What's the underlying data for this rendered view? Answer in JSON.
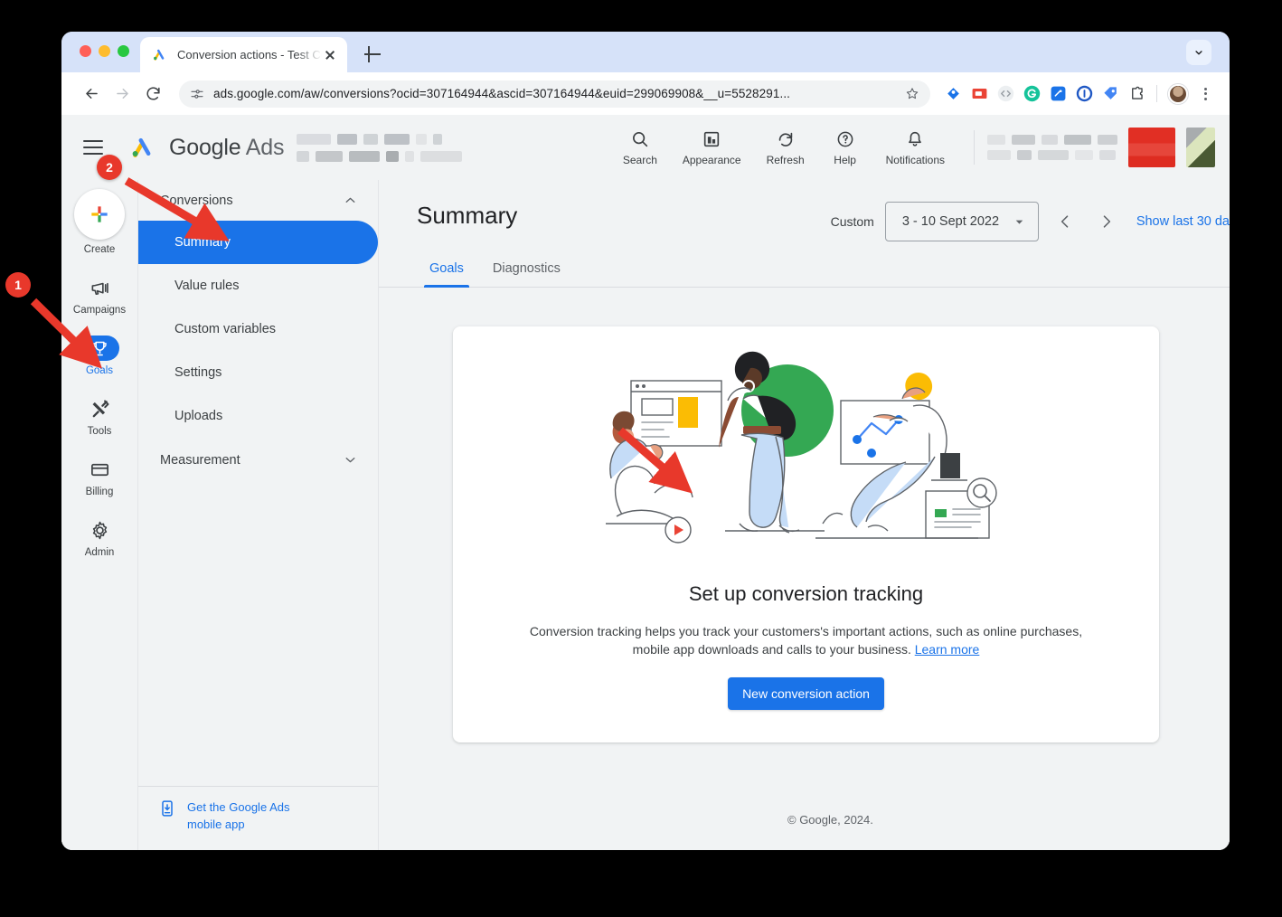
{
  "browser": {
    "tab": {
      "title": "Conversion actions - Test Cor",
      "favicon": "google-ads-favicon"
    },
    "new_tab_label": "+",
    "url": "ads.google.com/aw/conversions?ocid=307164944&ascid=307164944&euid=299069908&__u=5528291...",
    "extensions": [
      "tag-assistant-icon",
      "coupon-icon",
      "code-inspector-icon",
      "grammarly-icon",
      "tag-manager-icon",
      "1password-icon",
      "tag-blue-icon",
      "extensions-puzzle-icon"
    ],
    "profile": "profile-avatar",
    "menu": "chrome-menu-icon"
  },
  "appbar": {
    "menu_label": "hamburger-menu",
    "brand_google": "Google",
    "brand_ads": "Ads",
    "account_redacted": "[redacted account name]",
    "actions": [
      {
        "label": "Search",
        "icon": "search-icon"
      },
      {
        "label": "Appearance",
        "icon": "appearance-icon"
      },
      {
        "label": "Refresh",
        "icon": "refresh-icon"
      },
      {
        "label": "Help",
        "icon": "help-icon"
      },
      {
        "label": "Notifications",
        "icon": "bell-icon"
      }
    ]
  },
  "rail": {
    "items": [
      {
        "label": "Create",
        "icon": "plus-icon",
        "active": false
      },
      {
        "label": "Campaigns",
        "icon": "megaphone-icon",
        "active": false
      },
      {
        "label": "Goals",
        "icon": "trophy-icon",
        "active": true
      },
      {
        "label": "Tools",
        "icon": "tools-icon",
        "active": false
      },
      {
        "label": "Billing",
        "icon": "billing-card-icon",
        "active": false
      },
      {
        "label": "Admin",
        "icon": "gear-icon",
        "active": false
      }
    ]
  },
  "sidebar": {
    "section_conversions": "Conversions",
    "section_measurement": "Measurement",
    "items": [
      {
        "label": "Summary",
        "active": true
      },
      {
        "label": "Value rules",
        "active": false
      },
      {
        "label": "Custom variables",
        "active": false
      },
      {
        "label": "Settings",
        "active": false
      },
      {
        "label": "Uploads",
        "active": false
      }
    ],
    "footer_link": "Get the Google Ads mobile app",
    "footer_icon": "mobile-download-icon"
  },
  "content": {
    "page_title": "Summary",
    "date": {
      "label": "Custom",
      "value": "3 - 10 Sept 2022",
      "prev": "previous-period",
      "next": "next-period",
      "show_last": "Show last 30 da"
    },
    "tabs": [
      {
        "label": "Goals",
        "active": true
      },
      {
        "label": "Diagnostics",
        "active": false
      }
    ],
    "card": {
      "title": "Set up conversion tracking",
      "description": "Conversion tracking helps you track your customers's important actions, such as online purchases, mobile app downloads and calls to your business. ",
      "learn_more": "Learn more",
      "cta": "New conversion action",
      "illustration": "conversion-tracking-illustration"
    },
    "copyright": "© Google, 2024."
  },
  "annotations": {
    "badges": [
      {
        "number": "1",
        "target": "goals-rail-item"
      },
      {
        "number": "2",
        "target": "summary-sidebar-item"
      }
    ],
    "accent": "#e8382b"
  },
  "colors": {
    "primary": "#1a73e8",
    "chrome_tabstrip": "#d6e2f9",
    "app_background": "#f1f3f4",
    "annotation_red": "#e8382b"
  }
}
